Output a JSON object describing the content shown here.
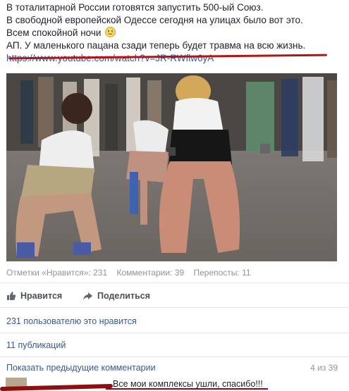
{
  "post": {
    "line1": "В тоталитарной России готовятся запустить 500-ый Союз.",
    "line2": "В свободной европейской Одессе сегодня на улицах было вот это.",
    "line3": "Всем спокойной ночи",
    "line4": "АП. У маленького пацана сзади теперь будет травма на всю жизнь.",
    "link": "https://www.youtube.com/watch?v=JR-RWflw6yA",
    "emoji": "smile-emoji"
  },
  "meta": {
    "likes_text": "Отметки «Нравится»: 231",
    "comments_text": "Комментарии: 39",
    "shares_text": "Перепосты: 11"
  },
  "actions": {
    "like_label": "Нравится",
    "share_label": "Поделиться"
  },
  "summary": {
    "likes": "231 пользователю это нравится",
    "shares": "11 публикаций"
  },
  "comments": {
    "show_previous": "Показать предыдущие комментарии",
    "pager": "4 из 39",
    "first_comment": "Все мои комплексы ушли, спасибо!!!"
  },
  "colors": {
    "link": "#365899",
    "muted": "#90949c",
    "annotation_red": "#b51414"
  }
}
